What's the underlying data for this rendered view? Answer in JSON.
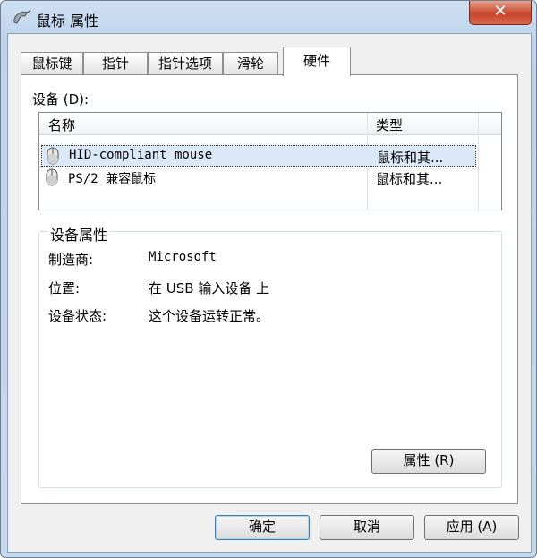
{
  "window": {
    "title": "鼠标 属性",
    "close_label": "✕"
  },
  "tabs": [
    {
      "label": "鼠标键"
    },
    {
      "label": "指针"
    },
    {
      "label": "指针选项"
    },
    {
      "label": "滑轮"
    },
    {
      "label": "硬件"
    }
  ],
  "active_tab": "硬件",
  "devices": {
    "label": "设备 (D):",
    "columns": {
      "name": "名称",
      "type": "类型"
    },
    "rows": [
      {
        "name": "HID-compliant mouse",
        "type": "鼠标和其...",
        "icon": "mouse-icon",
        "selected": true
      },
      {
        "name": "PS/2 兼容鼠标",
        "type": "鼠标和其...",
        "icon": "mouse-icon",
        "selected": false
      }
    ]
  },
  "properties": {
    "title": "设备属性",
    "manufacturer_label": "制造商:",
    "manufacturer_value": "Microsoft",
    "location_label": "位置:",
    "location_value": "在 USB 输入设备 上",
    "status_label": "设备状态:",
    "status_value": "这个设备运转正常。",
    "button_label": "属性 (R)"
  },
  "footer": {
    "ok": "确定",
    "cancel": "取消",
    "apply": "应用 (A)"
  }
}
